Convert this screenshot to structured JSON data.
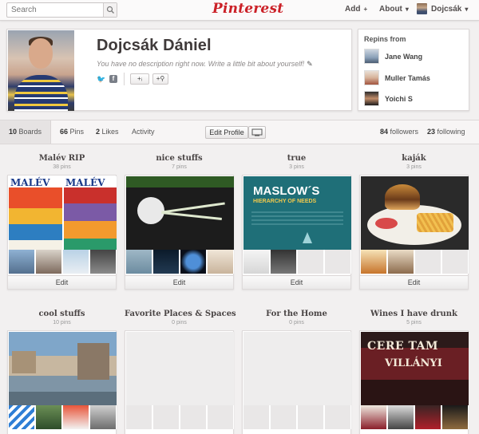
{
  "nav": {
    "search_placeholder": "Search",
    "add_label": "Add",
    "add_icon": "+",
    "about_label": "About",
    "about_icon": "▾",
    "user_label": "Dojcsák",
    "user_icon": "▾",
    "logo_text": "Pinterest"
  },
  "profile": {
    "name": "Dojcsák Dániel",
    "description": "You have no description right now. Write a little bit about yourself!",
    "follow_btn_1": "+ᵢ",
    "follow_btn_2": "+⚲"
  },
  "repins": {
    "title": "Repins from",
    "users": [
      {
        "name": "Jane Wang"
      },
      {
        "name": "Muller Tamás"
      },
      {
        "name": "Yoichi S"
      }
    ]
  },
  "tabs": {
    "boards_count": "10",
    "boards_label": "Boards",
    "pins_count": "66",
    "pins_label": "Pins",
    "likes_count": "2",
    "likes_label": "Likes",
    "activity_label": "Activity",
    "edit_profile": "Edit Profile",
    "followers_count": "84",
    "followers_label": "followers",
    "following_count": "23",
    "following_label": "following"
  },
  "boards": [
    {
      "title": "Malév RIP",
      "pins": "38 pins",
      "edit": "Edit"
    },
    {
      "title": "nice stuffs",
      "pins": "7 pins",
      "edit": "Edit"
    },
    {
      "title": "true",
      "pins": "3 pins",
      "edit": "Edit"
    },
    {
      "title": "kaják",
      "pins": "3 pins",
      "edit": "Edit"
    },
    {
      "title": "cool stuffs",
      "pins": "10 pins"
    },
    {
      "title": "Favorite Places & Spaces",
      "pins": "0 pins"
    },
    {
      "title": "For the Home",
      "pins": "0 pins"
    },
    {
      "title": "Wines I have drunk",
      "pins": "5 pins"
    }
  ],
  "covers": {
    "malev_1": "MALÉV",
    "malev_2": "MALÉV",
    "maslow_1": "MASLOW´S",
    "maslow_2": "HIERARCHY OF NEEDS",
    "wine_1": "CERE TAM",
    "wine_2": "VILLÁNYI"
  },
  "colors": {
    "brand_red": "#cb2027",
    "background": "#f2f0f0",
    "maslow_teal": "#1f6f78"
  }
}
